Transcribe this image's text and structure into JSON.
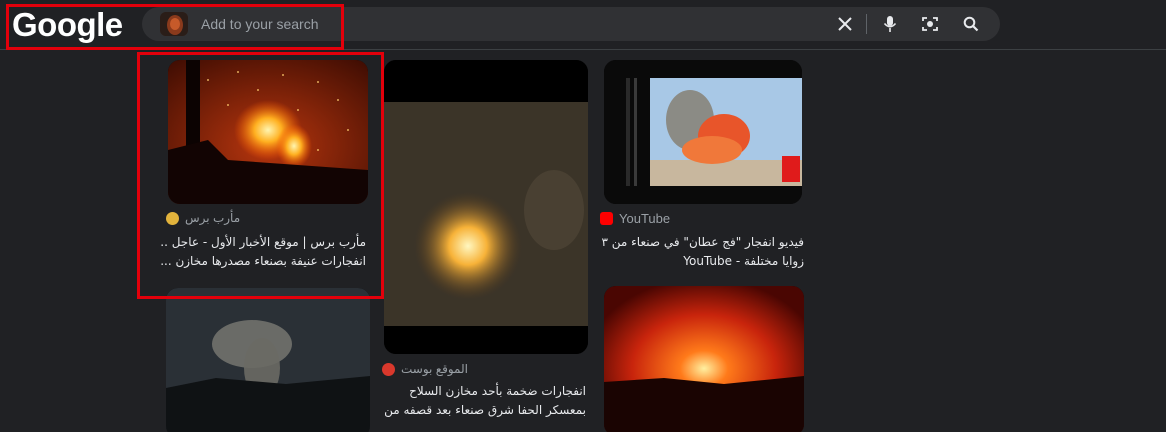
{
  "header": {
    "logo": "Google",
    "search_placeholder": "Add to your search"
  },
  "icons": {
    "clear": "close-icon",
    "voice": "microphone-icon",
    "lens": "camera-lens-icon",
    "search": "search-icon"
  },
  "results": [
    {
      "source": "مأرب برس",
      "title": "مأرب برس | موقع الأخبار الأول - عاجل .. انفجارات عنيفة بصنعاء مصدرها مخازن ..."
    },
    {
      "source": "YouTube",
      "title": "فيديو انفجار \"فج عطان\" في صنعاء من ٣ زوايا مختلفة - YouTube"
    },
    {
      "source": "الموقع بوست",
      "title": "انفجارات ضخمة بأحد مخازن السلاح بمعسكر الحفا شرق صنعاء بعد قصفه من قبل طيران ..."
    }
  ],
  "colors": {
    "background": "#202124",
    "highlight": "#e3000b",
    "youtube": "#ff0000"
  }
}
